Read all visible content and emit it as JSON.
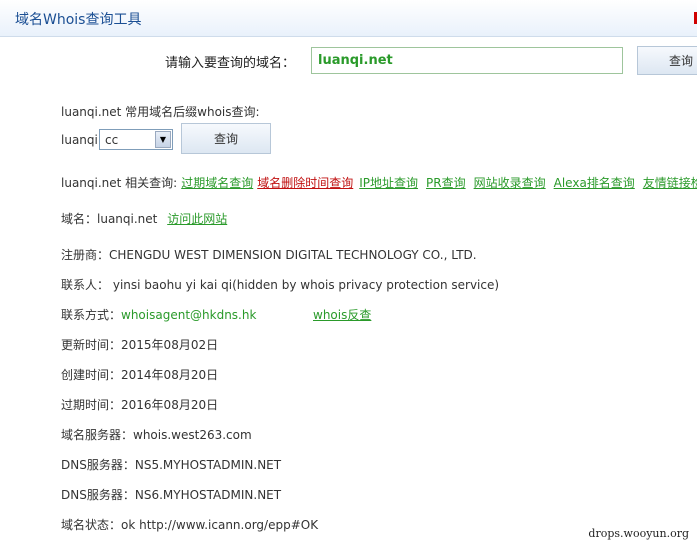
{
  "header": {
    "title": "域名Whois查询工具"
  },
  "search": {
    "prompt": "请输入要查询的域名：",
    "value": "luanqi.net",
    "button": "查询"
  },
  "suffix_query": {
    "heading": "luanqi.net 常用域名后缀whois查询:",
    "prefix": "luanqi.",
    "selected": "cc",
    "button": "查询"
  },
  "related": {
    "label": "luanqi.net 相关查询:",
    "links": [
      {
        "text": "过期域名查询",
        "color": "#2a9a2a"
      },
      {
        "text": "域名删除时间查询",
        "color": "#c01010"
      },
      {
        "text": "IP地址查询",
        "color": "#2a9a2a"
      },
      {
        "text": "PR查询",
        "color": "#2a9a2a"
      },
      {
        "text": "网站收录查询",
        "color": "#2a9a2a"
      },
      {
        "text": "Alexa排名查询",
        "color": "#2a9a2a"
      },
      {
        "text": "友情链接检测",
        "color": "#2a9a2a"
      }
    ]
  },
  "domain": {
    "label": "域名：",
    "value": "luanqi.net",
    "visit_link": "访问此网站"
  },
  "registrar": {
    "label": "注册商：",
    "value": "CHENGDU WEST DIMENSION DIGITAL TECHNOLOGY CO., LTD."
  },
  "contact": {
    "label": "联系人：",
    "value": "yinsi baohu yi kai qi(hidden by whois privacy protection service)"
  },
  "contact_method": {
    "label": "联系方式：",
    "email": "whoisagent@hkdns.hk",
    "reverse_link": "whois反查"
  },
  "updated": {
    "label": "更新时间：",
    "value": "2015年08月02日"
  },
  "created": {
    "label": "创建时间：",
    "value": "2014年08月20日"
  },
  "expires": {
    "label": "过期时间：",
    "value": "2016年08月20日"
  },
  "name_server": {
    "label": "域名服务器：",
    "value": "whois.west263.com"
  },
  "dns1": {
    "label": "DNS服务器：",
    "value": "NS5.MYHOSTADMIN.NET"
  },
  "dns2": {
    "label": "DNS服务器：",
    "value": "NS6.MYHOSTADMIN.NET"
  },
  "status": {
    "label": "域名状态：",
    "value": "ok http://www.icann.org/epp#OK"
  },
  "watermark": "drops.wooyun.org"
}
